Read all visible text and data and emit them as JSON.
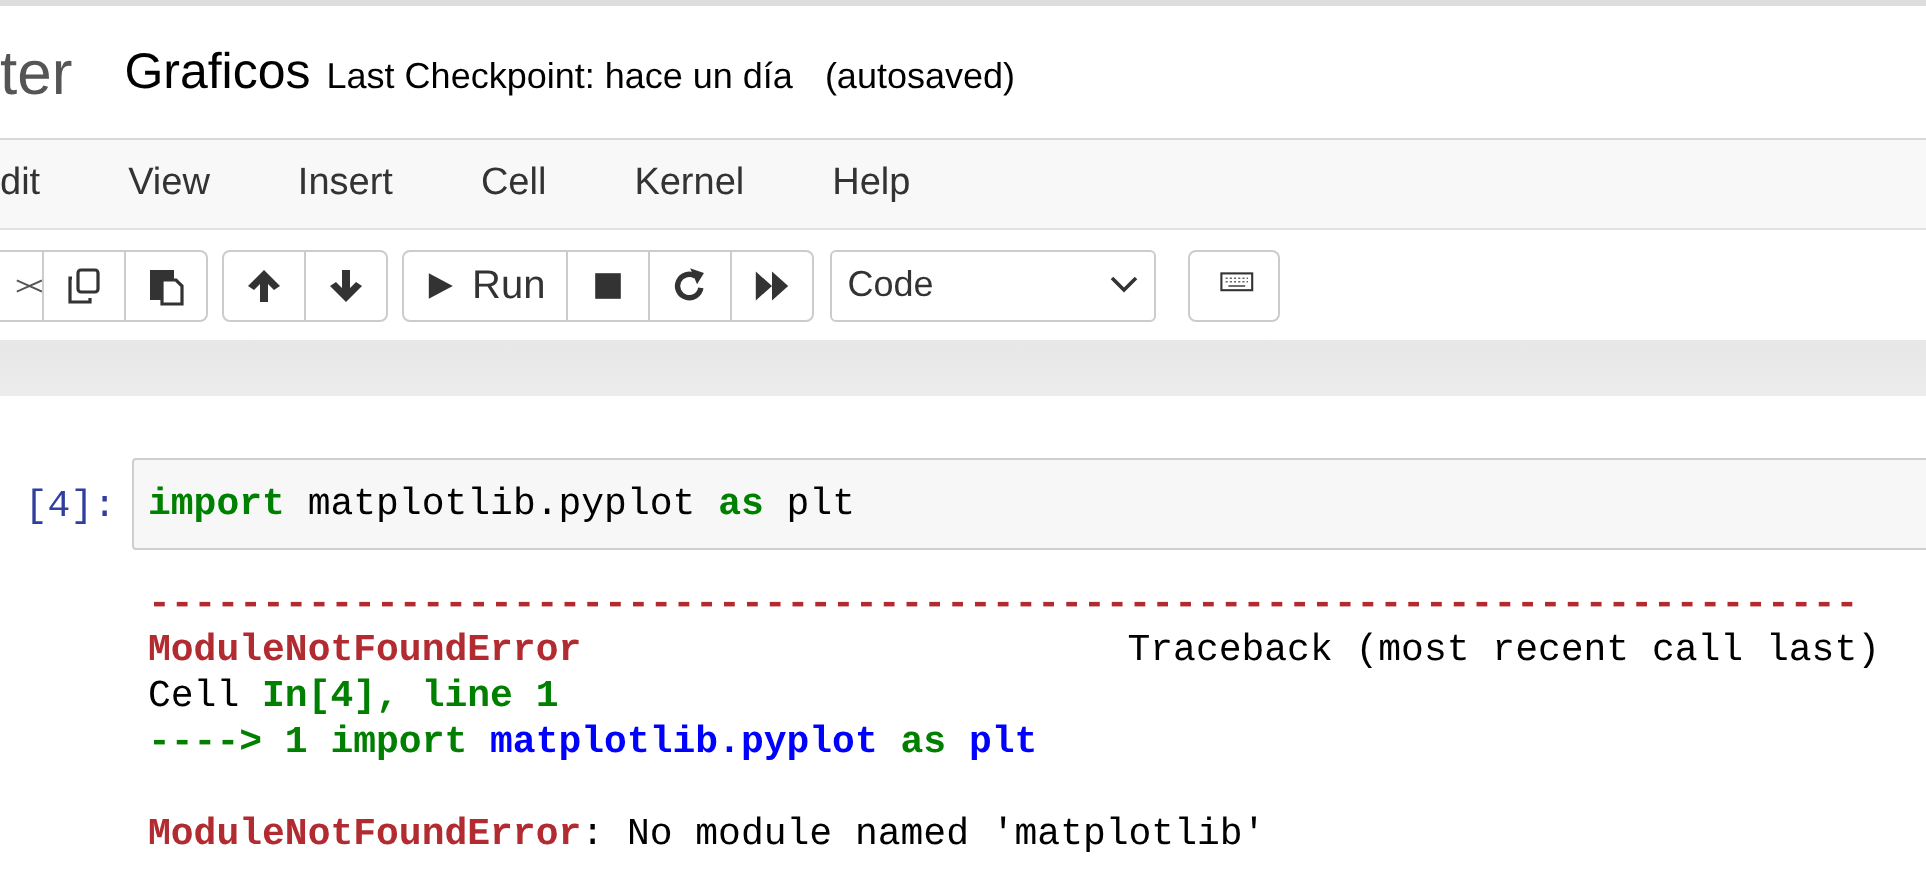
{
  "header": {
    "logo_text": "ter",
    "notebook_name": "Graficos",
    "checkpoint": "Last Checkpoint: hace un día",
    "autosave": "(autosaved)"
  },
  "menu": [
    "dit",
    "View",
    "Insert",
    "Cell",
    "Kernel",
    "Help"
  ],
  "toolbar": {
    "groups": [
      {
        "buttons": [
          {
            "kind": "cut"
          },
          {
            "kind": "copy"
          },
          {
            "kind": "paste"
          }
        ]
      },
      {
        "buttons": [
          {
            "kind": "up"
          },
          {
            "kind": "down"
          }
        ]
      },
      {
        "buttons": [
          {
            "kind": "run",
            "label": "Run"
          },
          {
            "kind": "stop"
          },
          {
            "kind": "restart"
          },
          {
            "kind": "fastforward"
          }
        ]
      }
    ],
    "cell_type": "Code",
    "keyboard": {
      "kind": "keyboard"
    }
  },
  "cell": {
    "prompt": "[4]:",
    "code": [
      {
        "kind": "keyword",
        "text": "import"
      },
      {
        "kind": "plain",
        "text": " matplotlib.pyplot "
      },
      {
        "kind": "keyword",
        "text": "as"
      },
      {
        "kind": "plain",
        "text": " plt"
      }
    ],
    "output": [
      {
        "kind": "rule",
        "segments": [
          {
            "kind": "error",
            "text": "---------------------------------------------------------------------------"
          }
        ]
      },
      {
        "kind": "split",
        "segments": [
          {
            "kind": "error",
            "text": "ModuleNotFoundError"
          },
          {
            "kind": "plain",
            "text": "Traceback (most recent call last)"
          }
        ]
      },
      {
        "kind": "line",
        "segments": [
          {
            "kind": "plain",
            "text": "Cell "
          },
          {
            "kind": "green",
            "text": "In[4], line 1"
          }
        ]
      },
      {
        "kind": "line",
        "segments": [
          {
            "kind": "green",
            "text": "----> 1 import "
          },
          {
            "kind": "blue",
            "text": "matplotlib.pyplot"
          },
          {
            "kind": "green",
            "text": " as "
          },
          {
            "kind": "blue",
            "text": "plt"
          }
        ]
      },
      {
        "kind": "blank"
      },
      {
        "kind": "line",
        "segments": [
          {
            "kind": "error",
            "text": "ModuleNotFoundError"
          },
          {
            "kind": "plain",
            "text": ": No module named 'matplotlib'"
          }
        ]
      }
    ]
  }
}
